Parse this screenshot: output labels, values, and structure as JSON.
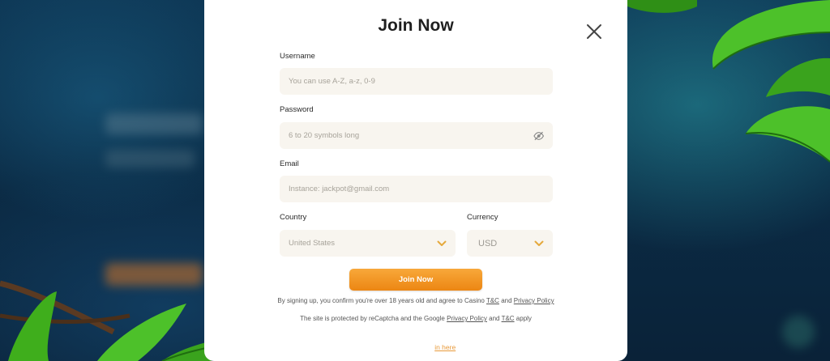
{
  "modal": {
    "title": "Join Now",
    "close_icon": "close-icon"
  },
  "form": {
    "username": {
      "label": "Username",
      "placeholder": "You can use A-Z, a-z, 0-9"
    },
    "password": {
      "label": "Password",
      "placeholder": "6 to 20 symbols long",
      "toggle_icon": "eye-slash-icon"
    },
    "email": {
      "label": "Email",
      "placeholder": "Instance: jackpot@gmail.com"
    },
    "country": {
      "label": "Country",
      "value": "United States",
      "icon": "chevron-down-icon"
    },
    "currency": {
      "label": "Currency",
      "value": "USD",
      "icon": "chevron-down-icon"
    },
    "submit_label": "Join Now"
  },
  "legal": {
    "line1_prefix": "By signing up, you confirm you're over 18 years old and agree to Casino",
    "line1_tc": "T&C",
    "line1_and": "and",
    "line1_privacy": "Privacy Policy",
    "line2_prefix": "The site is protected by reCaptcha and the Google",
    "line2_privacy": "Privacy Policy",
    "line2_and": "and",
    "line2_tc": "T&C",
    "line2_suffix": "apply"
  },
  "login": {
    "link_label": "in here"
  },
  "colors": {
    "accent": "#ee8a16",
    "leaf": "#3fae1c",
    "field_bg": "#f8f5ef",
    "chevron": "#e5a93c"
  }
}
